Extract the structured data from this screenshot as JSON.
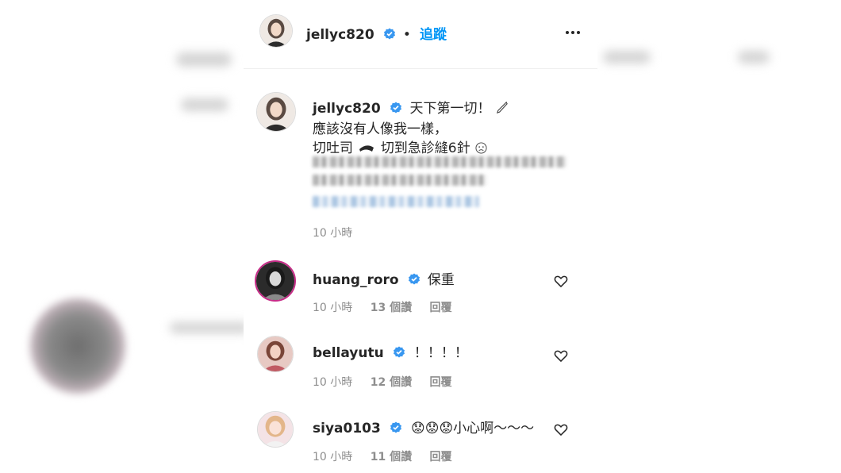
{
  "post": {
    "username": "jellyc820",
    "separator": "•",
    "follow_label": "追蹤",
    "caption_line1": "天下第一切！",
    "caption_line2": "應該沒有人像我一樣，",
    "caption_line3_a": "切吐司",
    "caption_line3_b": "切到急診縫6針",
    "time": "10 小時"
  },
  "comments": [
    {
      "username": "huang_roro",
      "text": "保重",
      "time": "10 小時",
      "likes": "13 個讚",
      "reply": "回覆"
    },
    {
      "username": "bellayutu",
      "text": "！！！！",
      "time": "10 小時",
      "likes": "12 個讚",
      "reply": "回覆"
    },
    {
      "username": "siya0103",
      "text": "😟😟😟小心啊～～～",
      "time": "10 小時",
      "likes": "11 個讚",
      "reply": "回覆"
    }
  ],
  "icons": {
    "verified": "verified-badge-icon",
    "more": "more-options-icon",
    "heart": "heart-outline-icon"
  },
  "colors": {
    "accent": "#0095f6",
    "verified": "#3897f0",
    "text": "#262626",
    "muted": "#8e8e8e"
  }
}
